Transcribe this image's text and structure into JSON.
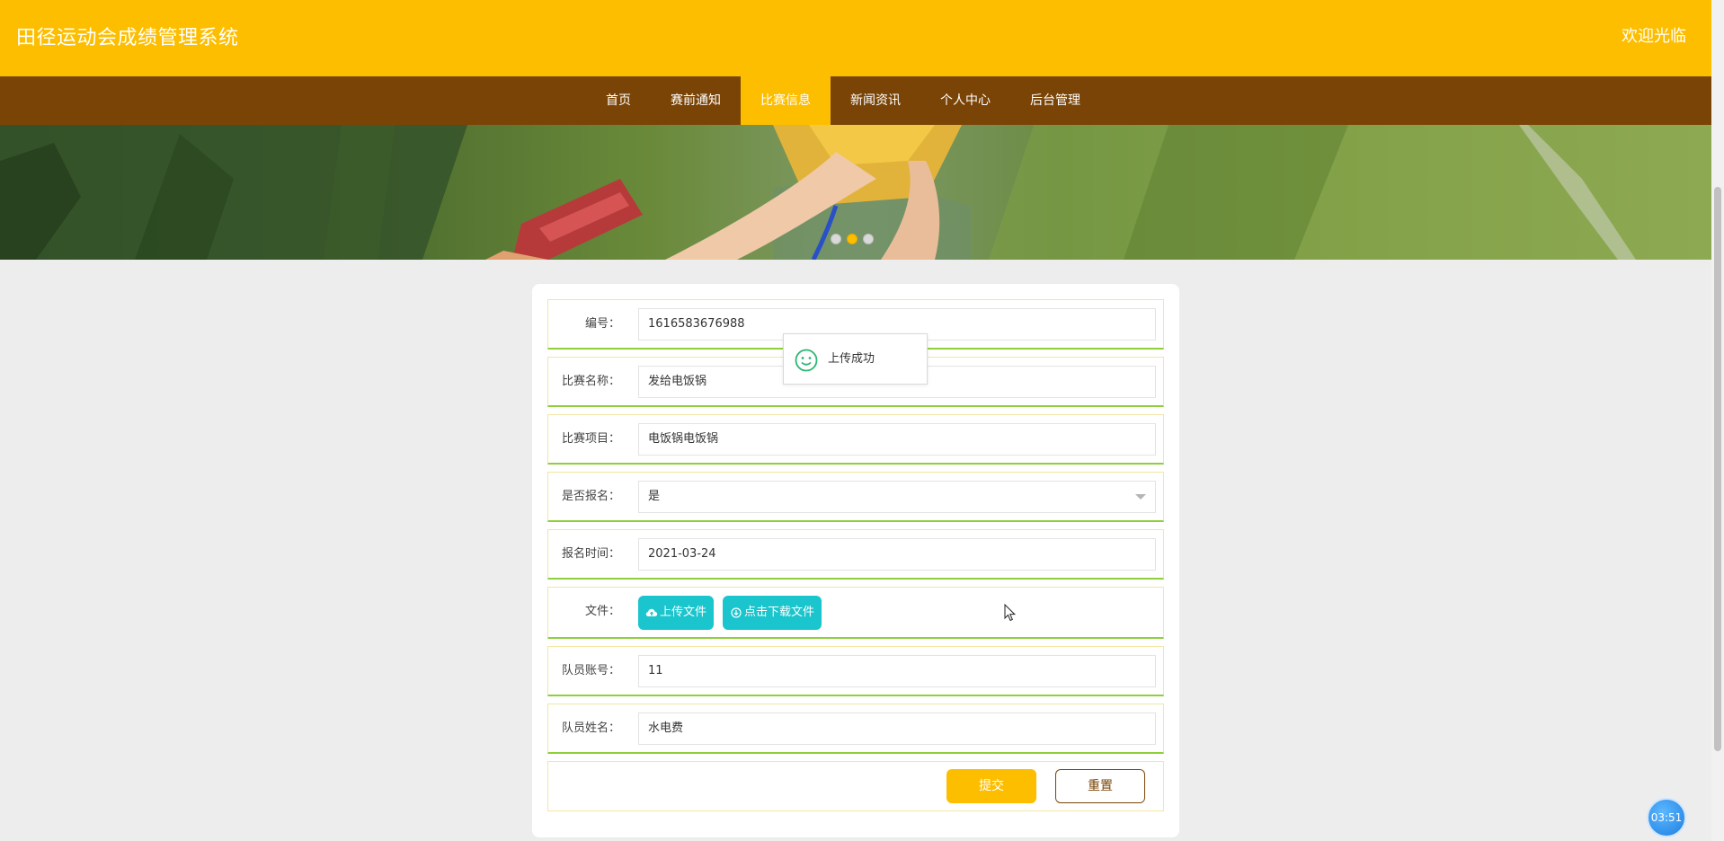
{
  "header": {
    "title": "田径运动会成绩管理系统",
    "welcome": "欢迎光临",
    "color": "#fdbe00"
  },
  "nav": {
    "color": "#7a4406",
    "items": [
      {
        "label": "首页",
        "active": false
      },
      {
        "label": "赛前通知",
        "active": false
      },
      {
        "label": "比赛信息",
        "active": true
      },
      {
        "label": "新闻资讯",
        "active": false
      },
      {
        "label": "个人中心",
        "active": false
      },
      {
        "label": "后台管理",
        "active": false
      }
    ]
  },
  "banner": {
    "slides": 3,
    "active_slide": 2
  },
  "form": {
    "fields": {
      "number": {
        "label": "编号：",
        "value": "1616583676988"
      },
      "match_name": {
        "label": "比赛名称：",
        "value": "发给电饭锅"
      },
      "match_item": {
        "label": "比赛项目：",
        "value": "电饭锅电饭锅"
      },
      "registered": {
        "label": "是否报名：",
        "value": "是"
      },
      "register_time": {
        "label": "报名时间：",
        "value": "2021-03-24"
      },
      "file": {
        "label": "文件：",
        "upload_label": "上传文件",
        "download_label": "点击下载文件"
      },
      "member_account": {
        "label": "队员账号：",
        "value": "11"
      },
      "member_name": {
        "label": "队员姓名：",
        "value": "水电费"
      }
    },
    "submit_label": "提交",
    "reset_label": "重置"
  },
  "toast": {
    "message": "上传成功",
    "icon": "smile-icon"
  },
  "clock": {
    "time": "03:51"
  }
}
